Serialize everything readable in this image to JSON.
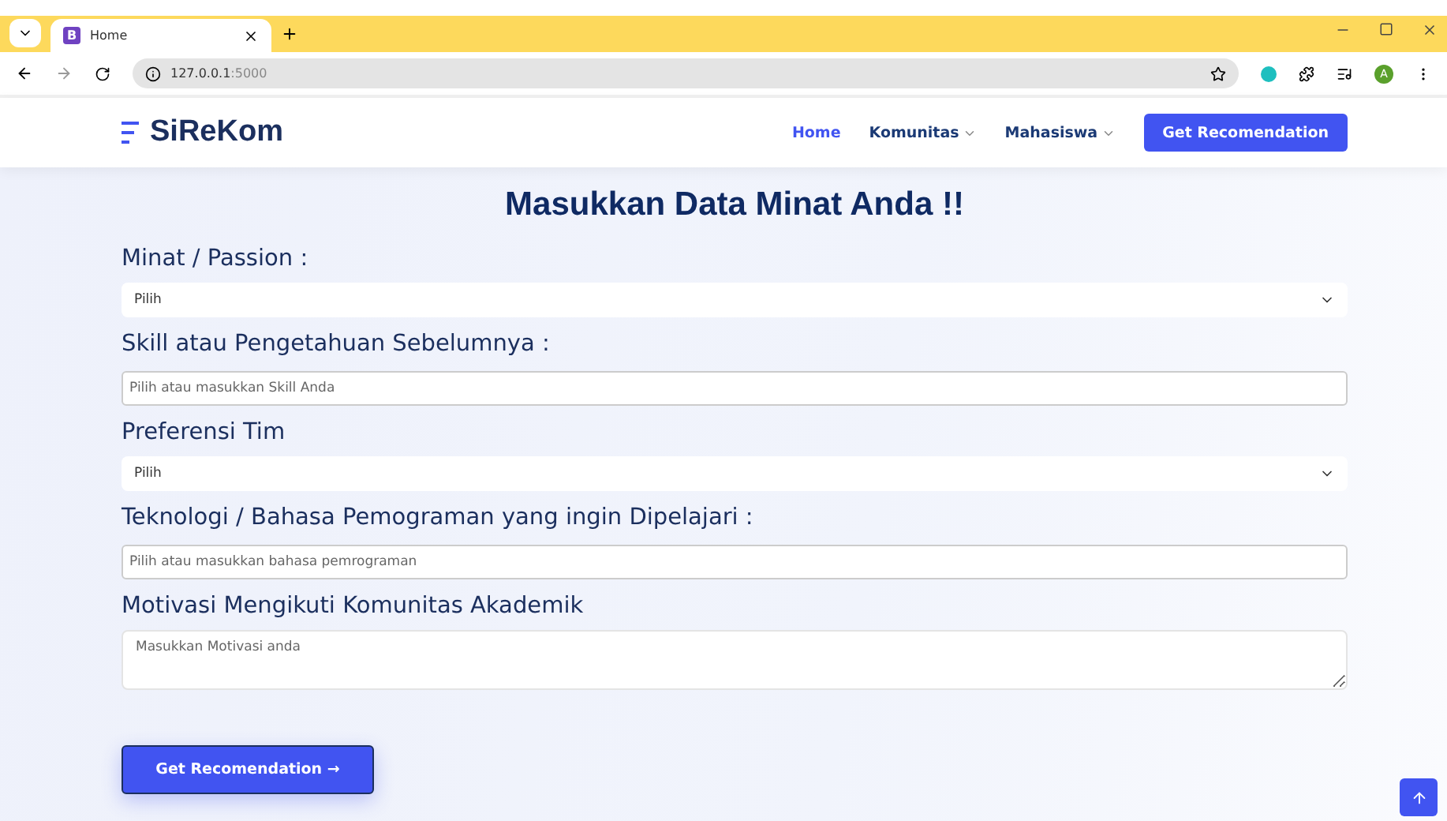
{
  "browser": {
    "tab_title": "Home",
    "tab_favicon": "B",
    "url_host": "127.0.0.1",
    "url_port": ":5000",
    "profile_initial": "A"
  },
  "navbar": {
    "brand": "SiReKom",
    "links": [
      {
        "label": "Home",
        "selected": true,
        "dropdown": false
      },
      {
        "label": "Komunitas",
        "selected": false,
        "dropdown": true
      },
      {
        "label": "Mahasiswa",
        "selected": false,
        "dropdown": true
      }
    ],
    "cta": "Get Recomendation"
  },
  "heading": "Masukkan Data Minat Anda !!",
  "fields": [
    {
      "label": "Minat / Passion :",
      "kind": "select",
      "value": "Pilih"
    },
    {
      "label": "Skill atau Pengetahuan Sebelumnya :",
      "kind": "input",
      "placeholder": "Pilih atau masukkan Skill Anda"
    },
    {
      "label": "Preferensi Tim",
      "kind": "select",
      "value": "Pilih"
    },
    {
      "label": "Teknologi / Bahasa Pemograman yang ingin Dipelajari :",
      "kind": "input",
      "placeholder": "Pilih atau masukkan bahasa pemrograman"
    },
    {
      "label": "Motivasi Mengikuti Komunitas Akademik",
      "kind": "textarea",
      "placeholder": "Masukkan Motivasi anda"
    }
  ],
  "submit": "Get Recomendation →"
}
